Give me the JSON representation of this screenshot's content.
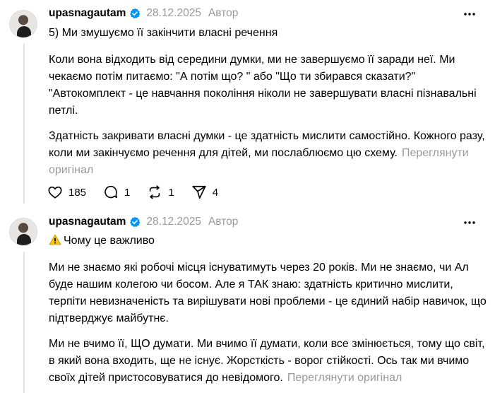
{
  "posts": [
    {
      "username": "upasnagautam",
      "date": "28.12.2025",
      "author_label": "Автор",
      "title": "5) Ми змушуємо її закінчити власні речення",
      "paragraphs": [
        "Коли вона відходить від середини думки, ми не завершуємо її заради неї. Ми чекаємо потім питаємо: \"А потім що? \" або \"Що ти збирався сказати?\" \"Автокомплект - це навчання покоління ніколи не завершувати власні пізнавальні петлі.",
        "Здатність закривати власні думки - це здатність мислити самостійно. Кожного разу, коли ми закінчуємо речення для дітей, ми послаблюємо цю схему."
      ],
      "translate_label": "Переглянути оригінал",
      "actions": {
        "likes": "185",
        "replies": "1",
        "reposts": "1",
        "shares": "4"
      }
    },
    {
      "username": "upasnagautam",
      "date": "28.12.2025",
      "author_label": "Автор",
      "title": "Чому це важливо",
      "title_icon": "warning-icon",
      "paragraphs": [
        "Ми не знаємо які робочі місця існуватимуть через 20 років. Ми не знаємо, чи Ал буде нашим колегою чи босом. Але я ТАК знаю: здатність критично мислити, терпіти невизначеність та вирішувати нові проблеми - це єдиний набір навичок, що підтверджує майбутнє.",
        "Ми не вчимо її, ЩО думати. Ми вчимо її думати, коли все змінюється, тому що світ, в який вона входить, ще не існує. Жорсткість - ворог стійкості. Ось так ми вчимо своїх дітей пристосовуватися до невідомого."
      ],
      "translate_label": "Переглянути оригінал"
    }
  ],
  "colors": {
    "muted": "#999999",
    "verified": "#0095f6",
    "thread_line": "#e3e3e3",
    "warning": "#f5c518"
  }
}
